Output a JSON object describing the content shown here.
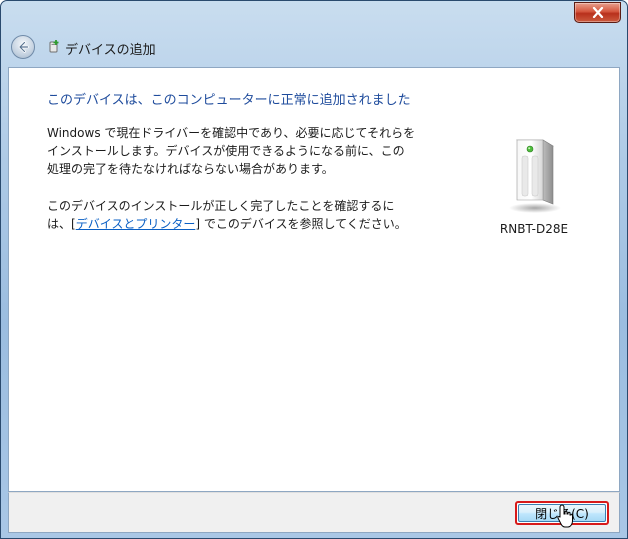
{
  "window": {
    "title": "デバイスの追加",
    "close_glyph": "x"
  },
  "content": {
    "heading": "このデバイスは、このコンピューターに正常に追加されました",
    "para1_line1": "Windows で現在ドライバーを確認中であり、必要に応じてそれらを",
    "para1_line2": "インストールします。デバイスが使用できるようになる前に、この",
    "para1_line3": "処理の完了を待たなければならない場合があります。",
    "para2_line1": "このデバイスのインストールが正しく完了したことを確認するに",
    "para2_prefix": "は、[",
    "para2_link": "デバイスとプリンター",
    "para2_suffix": "] でこのデバイスを参照してください。"
  },
  "device": {
    "icon": "external-drive-icon",
    "name": "RNBT-D28E"
  },
  "footer": {
    "close_button_label": "閉じる(C)"
  },
  "colors": {
    "heading": "#1e4b9c",
    "link": "#0a5fc4",
    "highlight_border": "#d71a1a"
  }
}
